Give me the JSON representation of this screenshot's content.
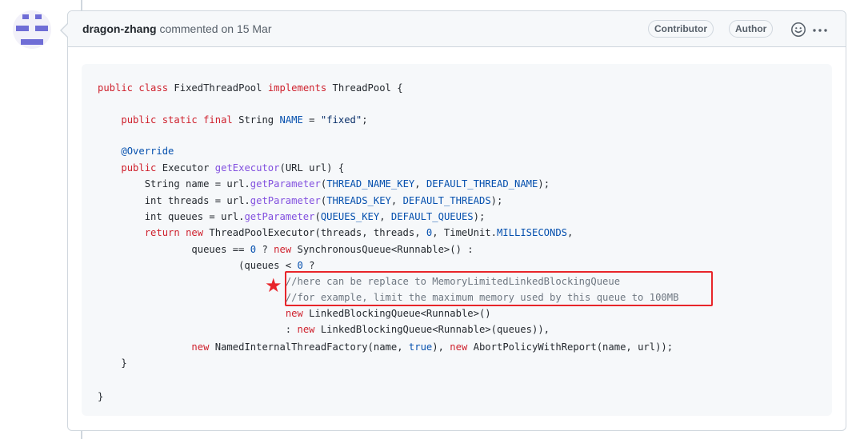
{
  "comment": {
    "author": "dragon-zhang",
    "action": "commented on",
    "date": "15 Mar",
    "badges": {
      "contributor": "Contributor",
      "author": "Author"
    },
    "icons": {
      "reaction": "smiley-icon",
      "menu": "kebab-horizontal-icon",
      "avatar": "identicon-avatar",
      "annotation": "red-star-icon"
    },
    "annotation_star": "★"
  },
  "colors": {
    "keyword": "#cf222e",
    "constant": "#0550ae",
    "function": "#8250df",
    "string": "#0a3069",
    "comment": "#6e7781",
    "highlight": "#e8252a"
  },
  "code": {
    "language": "java",
    "lines": [
      [
        "public class",
        " FixedThreadPool ",
        "implements",
        " ThreadPool {"
      ],
      [],
      [
        "    ",
        "public static final",
        " String ",
        "NAME",
        " = ",
        "\"fixed\"",
        ";"
      ],
      [],
      [
        "    ",
        "@Override"
      ],
      [
        "    ",
        "public",
        " Executor ",
        "getExecutor",
        "(URL url) {"
      ],
      [
        "        String name = url.",
        "getParameter",
        "(",
        "THREAD_NAME_KEY",
        ", ",
        "DEFAULT_THREAD_NAME",
        ");"
      ],
      [
        "        int threads = url.",
        "getParameter",
        "(",
        "THREADS_KEY",
        ", ",
        "DEFAULT_THREADS",
        ");"
      ],
      [
        "        int queues = url.",
        "getParameter",
        "(",
        "QUEUES_KEY",
        ", ",
        "DEFAULT_QUEUES",
        ");"
      ],
      [
        "        ",
        "return new",
        " ThreadPoolExecutor(threads, threads, ",
        "0",
        ", TimeUnit.",
        "MILLISECONDS",
        ","
      ],
      [
        "                queues == ",
        "0",
        " ? ",
        "new",
        " SynchronousQueue<Runnable>() :"
      ],
      [
        "                        (queues < ",
        "0",
        " ?"
      ],
      [
        "                                ",
        "//here can be replace to MemoryLimitedLinkedBlockingQueue"
      ],
      [
        "                                ",
        "//for example, limit the maximum memory used by this queue to 100MB"
      ],
      [
        "                                ",
        "new",
        " LinkedBlockingQueue<Runnable>()"
      ],
      [
        "                                : ",
        "new",
        " LinkedBlockingQueue<Runnable>(queues)),"
      ],
      [
        "                ",
        "new",
        " NamedInternalThreadFactory(name, ",
        "true",
        "), ",
        "new",
        " AbortPolicyWithReport(name, url));"
      ],
      [
        "    }"
      ],
      [],
      [
        "}"
      ]
    ]
  }
}
